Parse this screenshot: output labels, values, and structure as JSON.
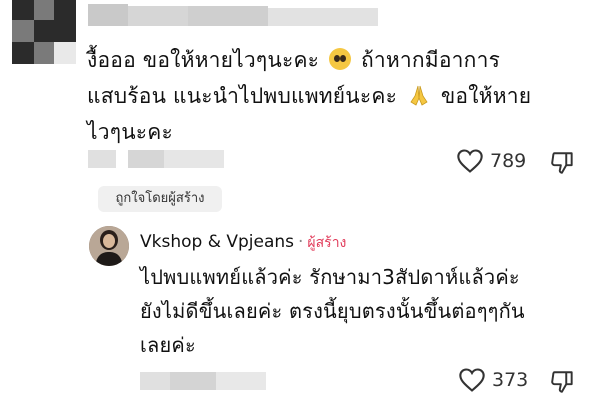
{
  "comment": {
    "text_line1": "งื้อออ ขอให้หายไวๆนะคะ",
    "text_line1b": "ถ้าหากมีอาการ",
    "text_line2a": "แสบร้อน แนะนำไปพบแพทย์นะคะ",
    "text_line2b": "ขอให้หาย",
    "text_line3": "ไวๆนะคะ",
    "like_count": "789"
  },
  "author_badge": "ถูกใจโดยผู้สร้าง",
  "reply": {
    "username": "Vkshop & Vpjeans",
    "separator": "·",
    "creator_tag": "ผู้สร้าง",
    "text_line1": "ไปพบแพทย์แล้วค่ะ รักษามา3สัปดาห์แล้วค่ะ",
    "text_line2": "ยังไม่ดีขึ้นเลยค่ะ ตรงนี้ยุบตรงนั้นขึ้นต่อๆๆกัน",
    "text_line3": "เลยค่ะ",
    "like_count": "373"
  },
  "icons": {
    "like": "heart-outline-icon",
    "dislike": "thumbs-down-outline-icon",
    "emoji1": "pleading-face-emoji",
    "emoji2": "folded-hands-emoji"
  },
  "colors": {
    "creator_tag": "#e13b5a",
    "badge_bg": "#f0f0f0"
  }
}
